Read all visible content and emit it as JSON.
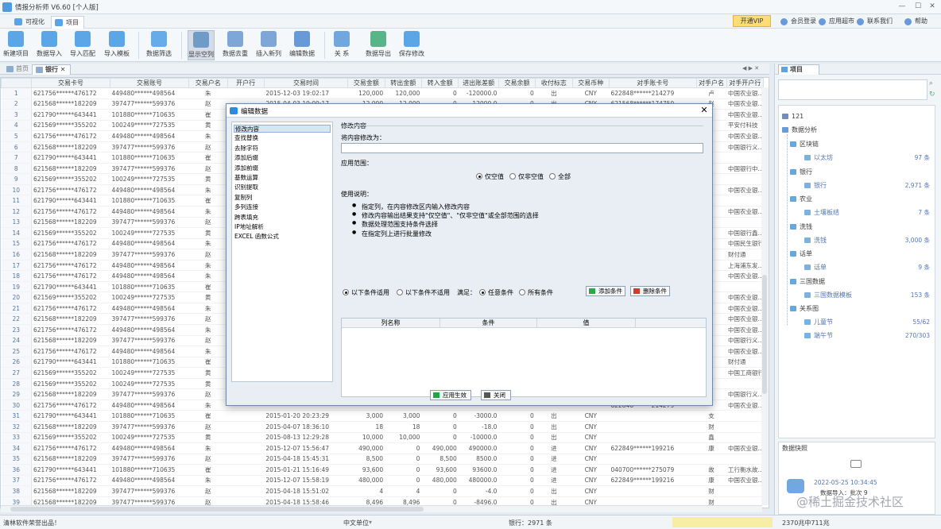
{
  "window": {
    "title": "情报分析师 V6.60 [个人版]",
    "minimize": "—",
    "maximize": "☐",
    "close": "✕"
  },
  "menu": {
    "tabs": [
      "可视化",
      "项目"
    ],
    "vip": "开通VIP",
    "actions": [
      "会员登录",
      "应用超市",
      "联系我们",
      "帮助"
    ]
  },
  "toolbar": {
    "buttons": [
      "新建项目",
      "数据导入",
      "导入匹配",
      "导入模板",
      "数据筛选",
      "显示空列",
      "数据去重",
      "插入新列",
      "编辑数据",
      "关 系",
      "数据导出",
      "保存修改"
    ]
  },
  "doc_tabs": [
    "首页",
    "银行"
  ],
  "grid": {
    "columns": [
      "",
      "交易卡号",
      "交易账号",
      "交易户名",
      "开户行",
      "交易时间",
      "交易金额",
      "转出金额",
      "转入金额",
      "进出账差额",
      "交易余额",
      "收付标志",
      "交易币种",
      "对手账卡号",
      "对手户名",
      "对手开户行"
    ],
    "rows": [
      [
        "1",
        "621756******476172",
        "449480******498564",
        "朱",
        "",
        "2015-12-03 19:02:17",
        "120,000",
        "120,000",
        "0",
        "-120000.0",
        "0",
        "出",
        "CNY",
        "622848******214279",
        "卢",
        "中国农业银…"
      ],
      [
        "2",
        "621568******182209",
        "397477******599376",
        "赵",
        "",
        "2015-04-03 19:09:17",
        "12,000",
        "12,000",
        "0",
        "-12000.0",
        "0",
        "出",
        "CNY",
        "621568******174759",
        "赵",
        "中国农业银…"
      ],
      [
        "3",
        "621790******643441",
        "101880******710635",
        "崔",
        "",
        "",
        "",
        "",
        "",
        "",
        "",
        "",
        "",
        "",
        "",
        "中国农业银…"
      ],
      [
        "4",
        "621569******355202",
        "100249******727535",
        "黄",
        "",
        "",
        "",
        "",
        "",
        "",
        "",
        "",
        "",
        "",
        "",
        "平安付科技"
      ],
      [
        "5",
        "621756******476172",
        "449480******498564",
        "朱",
        "",
        "",
        "",
        "",
        "",
        "",
        "",
        "",
        "",
        "",
        "",
        "中国农业银…"
      ],
      [
        "6",
        "621568******182209",
        "397477******599376",
        "赵",
        "",
        "",
        "",
        "",
        "",
        "",
        "",
        "",
        "",
        "",
        "",
        "中国银行义…"
      ],
      [
        "7",
        "621790******643441",
        "101880******710635",
        "崔",
        "",
        "",
        "",
        "",
        "",
        "",
        "",
        "",
        "",
        "",
        "",
        ""
      ],
      [
        "8",
        "621568******182209",
        "397477******599376",
        "赵",
        "",
        "",
        "",
        "",
        "",
        "",
        "",
        "",
        "",
        "",
        "",
        "中国银行中…"
      ],
      [
        "9",
        "621569******355202",
        "100249******727535",
        "黄",
        "",
        "",
        "",
        "",
        "",
        "",
        "",
        "",
        "",
        "",
        "",
        ""
      ],
      [
        "10",
        "621756******476172",
        "449480******498564",
        "朱",
        "",
        "",
        "",
        "",
        "",
        "",
        "",
        "",
        "",
        "",
        "",
        "中国农业银…"
      ],
      [
        "11",
        "621790******643441",
        "101880******710635",
        "崔",
        "",
        "",
        "",
        "",
        "",
        "",
        "",
        "",
        "",
        "",
        "",
        ""
      ],
      [
        "12",
        "621756******476172",
        "449480******498564",
        "朱",
        "",
        "",
        "",
        "",
        "",
        "",
        "",
        "",
        "",
        "",
        "",
        "中国农业银…"
      ],
      [
        "13",
        "621568******182209",
        "397477******599376",
        "赵",
        "",
        "",
        "",
        "",
        "",
        "",
        "",
        "",
        "",
        "",
        "",
        ""
      ],
      [
        "14",
        "621569******355202",
        "100249******727535",
        "黄",
        "",
        "",
        "",
        "",
        "",
        "",
        "",
        "",
        "",
        "",
        "",
        "中国银行鑫…"
      ],
      [
        "15",
        "621756******476172",
        "449480******498564",
        "朱",
        "",
        "",
        "",
        "",
        "",
        "",
        "",
        "",
        "",
        "",
        "",
        "中国民生银行"
      ],
      [
        "16",
        "621568******182209",
        "397477******599376",
        "赵",
        "",
        "",
        "",
        "",
        "",
        "",
        "",
        "",
        "",
        "",
        "",
        "财付通"
      ],
      [
        "17",
        "621756******476172",
        "449480******498564",
        "朱",
        "",
        "",
        "",
        "",
        "",
        "",
        "",
        "",
        "",
        "",
        "",
        "上海浦东发…"
      ],
      [
        "18",
        "621756******476172",
        "449480******498564",
        "朱",
        "",
        "",
        "",
        "",
        "",
        "",
        "",
        "",
        "",
        "",
        "",
        "中国农业银…"
      ],
      [
        "19",
        "621790******643441",
        "101880******710635",
        "崔",
        "",
        "",
        "",
        "",
        "",
        "",
        "",
        "",
        "",
        "",
        "",
        ""
      ],
      [
        "20",
        "621569******355202",
        "100249******727535",
        "黄",
        "",
        "",
        "",
        "",
        "",
        "",
        "",
        "",
        "",
        "",
        "",
        "中国农业银…"
      ],
      [
        "21",
        "621756******476172",
        "449480******498564",
        "朱",
        "",
        "",
        "",
        "",
        "",
        "",
        "",
        "",
        "",
        "",
        "",
        "中国农业银…"
      ],
      [
        "22",
        "621568******182209",
        "397477******599376",
        "赵",
        "",
        "",
        "",
        "",
        "",
        "",
        "",
        "",
        "",
        "",
        "",
        "中国农业银…"
      ],
      [
        "23",
        "621756******476172",
        "449480******498564",
        "朱",
        "",
        "",
        "",
        "",
        "",
        "",
        "",
        "",
        "",
        "",
        "",
        "中国农业银…"
      ],
      [
        "24",
        "621568******182209",
        "397477******599376",
        "赵",
        "",
        "",
        "",
        "",
        "",
        "",
        "",
        "",
        "",
        "",
        "",
        "中国银行义…"
      ],
      [
        "25",
        "621756******476172",
        "449480******498564",
        "朱",
        "",
        "",
        "",
        "",
        "",
        "",
        "",
        "",
        "",
        "",
        "",
        "中国农业银…"
      ],
      [
        "26",
        "621790******643441",
        "101880******710635",
        "崔",
        "",
        "",
        "",
        "",
        "",
        "",
        "",
        "",
        "",
        "",
        "",
        "财付通"
      ],
      [
        "27",
        "621569******355202",
        "100249******727535",
        "黄",
        "",
        "",
        "",
        "",
        "",
        "",
        "",
        "",
        "",
        "",
        "",
        "中国工商银行"
      ],
      [
        "28",
        "621569******355202",
        "100249******727535",
        "黄",
        "",
        "",
        "",
        "",
        "",
        "",
        "",
        "",
        "",
        "",
        "",
        ""
      ],
      [
        "29",
        "621568******182209",
        "397477******599376",
        "赵",
        "",
        "",
        "",
        "",
        "",
        "",
        "",
        "",
        "",
        "",
        "",
        "中国银行义…"
      ],
      [
        "30",
        "621756******476172",
        "449480******498564",
        "朱",
        "",
        "",
        "",
        "",
        "",
        "",
        "",
        "",
        "",
        "622848******214279",
        "",
        "中国农业银…"
      ],
      [
        "31",
        "621790******643441",
        "101880******710635",
        "崔",
        "",
        "2015-01-20 20:23:29",
        "3,000",
        "3,000",
        "0",
        "-3000.0",
        "0",
        "出",
        "CNY",
        "",
        "支",
        ""
      ],
      [
        "32",
        "621568******182209",
        "397477******599376",
        "赵",
        "",
        "2015-04-07 18:36:10",
        "18",
        "18",
        "0",
        "-18.0",
        "0",
        "出",
        "CNY",
        "",
        "财",
        ""
      ],
      [
        "33",
        "621569******355202",
        "100249******727535",
        "黄",
        "",
        "2015-08-13 12:29:28",
        "10,000",
        "10,000",
        "0",
        "-10000.0",
        "0",
        "出",
        "CNY",
        "",
        "鑫",
        ""
      ],
      [
        "34",
        "621756******476172",
        "449480******498564",
        "朱",
        "",
        "2015-12-07 15:56:47",
        "490,000",
        "0",
        "490,000",
        "490000.0",
        "0",
        "进",
        "CNY",
        "622849******199216",
        "康",
        "中国农业银…"
      ],
      [
        "35",
        "621568******182209",
        "397477******599376",
        "赵",
        "",
        "2015-04-18 15:45:31",
        "8,500",
        "0",
        "8,500",
        "8500.0",
        "0",
        "进",
        "CNY",
        "",
        "",
        ""
      ],
      [
        "36",
        "621790******643441",
        "101880******710635",
        "崔",
        "",
        "2015-01-21 15:16:49",
        "93,600",
        "0",
        "93,600",
        "93600.0",
        "0",
        "进",
        "CNY",
        "040700******275079",
        "故",
        "工行衡水故…"
      ],
      [
        "37",
        "621756******476172",
        "449480******498564",
        "朱",
        "",
        "2015-12-07 15:58:19",
        "480,000",
        "0",
        "480,000",
        "480000.0",
        "0",
        "进",
        "CNY",
        "622849******199216",
        "康",
        "中国农业银…"
      ],
      [
        "38",
        "621568******182209",
        "397477******599376",
        "赵",
        "",
        "2015-04-18 15:51:02",
        "4",
        "4",
        "0",
        "-4.0",
        "0",
        "出",
        "CNY",
        "",
        "财",
        ""
      ],
      [
        "39",
        "621568******182209",
        "397477******599376",
        "赵",
        "",
        "2015-04-18 15:58:46",
        "8,496",
        "8,496",
        "0",
        "-8496.0",
        "0",
        "出",
        "CNY",
        "",
        "财",
        ""
      ]
    ]
  },
  "right_panel": {
    "tab": "项目",
    "tree": {
      "root": "121",
      "project": "数据分析",
      "groups": [
        {
          "name": "区块链",
          "child": "以太坊",
          "count": "97 条"
        },
        {
          "name": "银行",
          "child": "银行",
          "count": "2,971 条"
        },
        {
          "name": "农业",
          "child": "土壤板结",
          "count": "7 条"
        },
        {
          "name": "洗钱",
          "child": "洗钱",
          "count": "3,000 条"
        },
        {
          "name": "话单",
          "child": "话单",
          "count": "9 条"
        },
        {
          "name": "三国数据",
          "child": "三国数据模板",
          "count": "153 条"
        }
      ],
      "relation_group": "关系图",
      "relations": [
        {
          "name": "儿童节",
          "count": "55/62"
        },
        {
          "name": "端午节",
          "count": "270/303"
        }
      ]
    },
    "snapshot": {
      "title": "数据快照",
      "time": "2022-05-25 10:34:45",
      "desc": "数据导入：批次 9"
    }
  },
  "dialog": {
    "title": "编辑数据",
    "menu": [
      "修改内容",
      "查找替换",
      "去除字符",
      "添加后缀",
      "添加前缀",
      "基数运算",
      "识别提取",
      "复制列",
      "多列连接",
      "跨表填充",
      "IP地址解析",
      "EXCEL 函数公式"
    ],
    "section": "修改内容",
    "field_label": "将内容修改为：",
    "field_value": "",
    "scope_label": "应用范围：",
    "scope_options": [
      "仅空值",
      "仅非空值",
      "全部"
    ],
    "usage_label": "使用说明：",
    "usage": [
      "指定列，在内容修改区内输入修改内容",
      "修改内容输出结果支持\"仅空值\"、\"仅非空值\"或全部范围的选择",
      "数据处理范围支持条件选择",
      "在指定列上进行批量修改"
    ],
    "cond_options": [
      "以下条件适用",
      "以下条件不适用"
    ],
    "satisfy_label": "满足：",
    "satisfy_options": [
      "任意条件",
      "所有条件"
    ],
    "add_condition": "添加条件",
    "delete_condition": "删除条件",
    "cond_columns": [
      "列名称",
      "条件",
      "值"
    ],
    "apply": "应用生效",
    "close": "关闭"
  },
  "status": {
    "left": "清林软件荣誉出品！",
    "unit": "中文单位",
    "count": "银行：2971 条",
    "right": "2370兆中711兆",
    "watermark": "@稀土掘金技术社区"
  },
  "colors": {
    "accent": "#2c8ae0",
    "vip": "#ffd34d",
    "selection": "#d7e6f6"
  }
}
